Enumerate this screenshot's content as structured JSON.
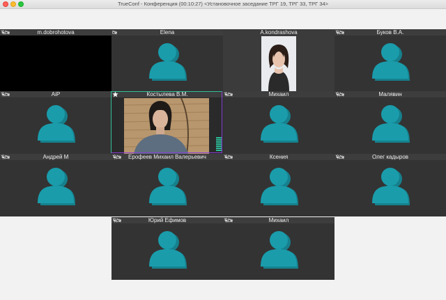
{
  "window": {
    "title": "TrueConf - Конференция (00:10:27) <Установочное заседание ТРГ 19, ТРГ 33, ТРГ 34>"
  },
  "colors": {
    "tile_bg": "#333333",
    "tile_header": "#3d3d3d",
    "avatar": "#1a9cab",
    "avatar_shadow": "#16808d",
    "speaker_frame": "#2fbf98",
    "active_frame": "#8b3fd6"
  },
  "icons": {
    "mic": "microphone-off-icon",
    "camera": "camera-off-icon",
    "pin": "star-icon",
    "placeholder": "user-avatar-icon"
  },
  "participants": [
    {
      "name": "m.dobrohotova",
      "view": "black"
    },
    {
      "name": "Elena",
      "view": "avatar"
    },
    {
      "name": "A.kondrashova",
      "view": "video"
    },
    {
      "name": "Буков В.А.",
      "view": "avatar"
    },
    {
      "name": "AiP",
      "view": "avatar"
    },
    {
      "name": "Костылева В.М.",
      "view": "video",
      "pinned": true
    },
    {
      "name": "Михаил",
      "view": "avatar"
    },
    {
      "name": "Малявин",
      "view": "avatar"
    },
    {
      "name": "Андрей М",
      "view": "avatar"
    },
    {
      "name": "Ерофеев Михаил Валерьевич",
      "view": "avatar"
    },
    {
      "name": "Ксения",
      "view": "avatar"
    },
    {
      "name": "Олег кадыров",
      "view": "avatar"
    },
    {
      "name": "Юрий Ефимов",
      "view": "avatar"
    },
    {
      "name": "Михаил",
      "view": "avatar"
    }
  ]
}
